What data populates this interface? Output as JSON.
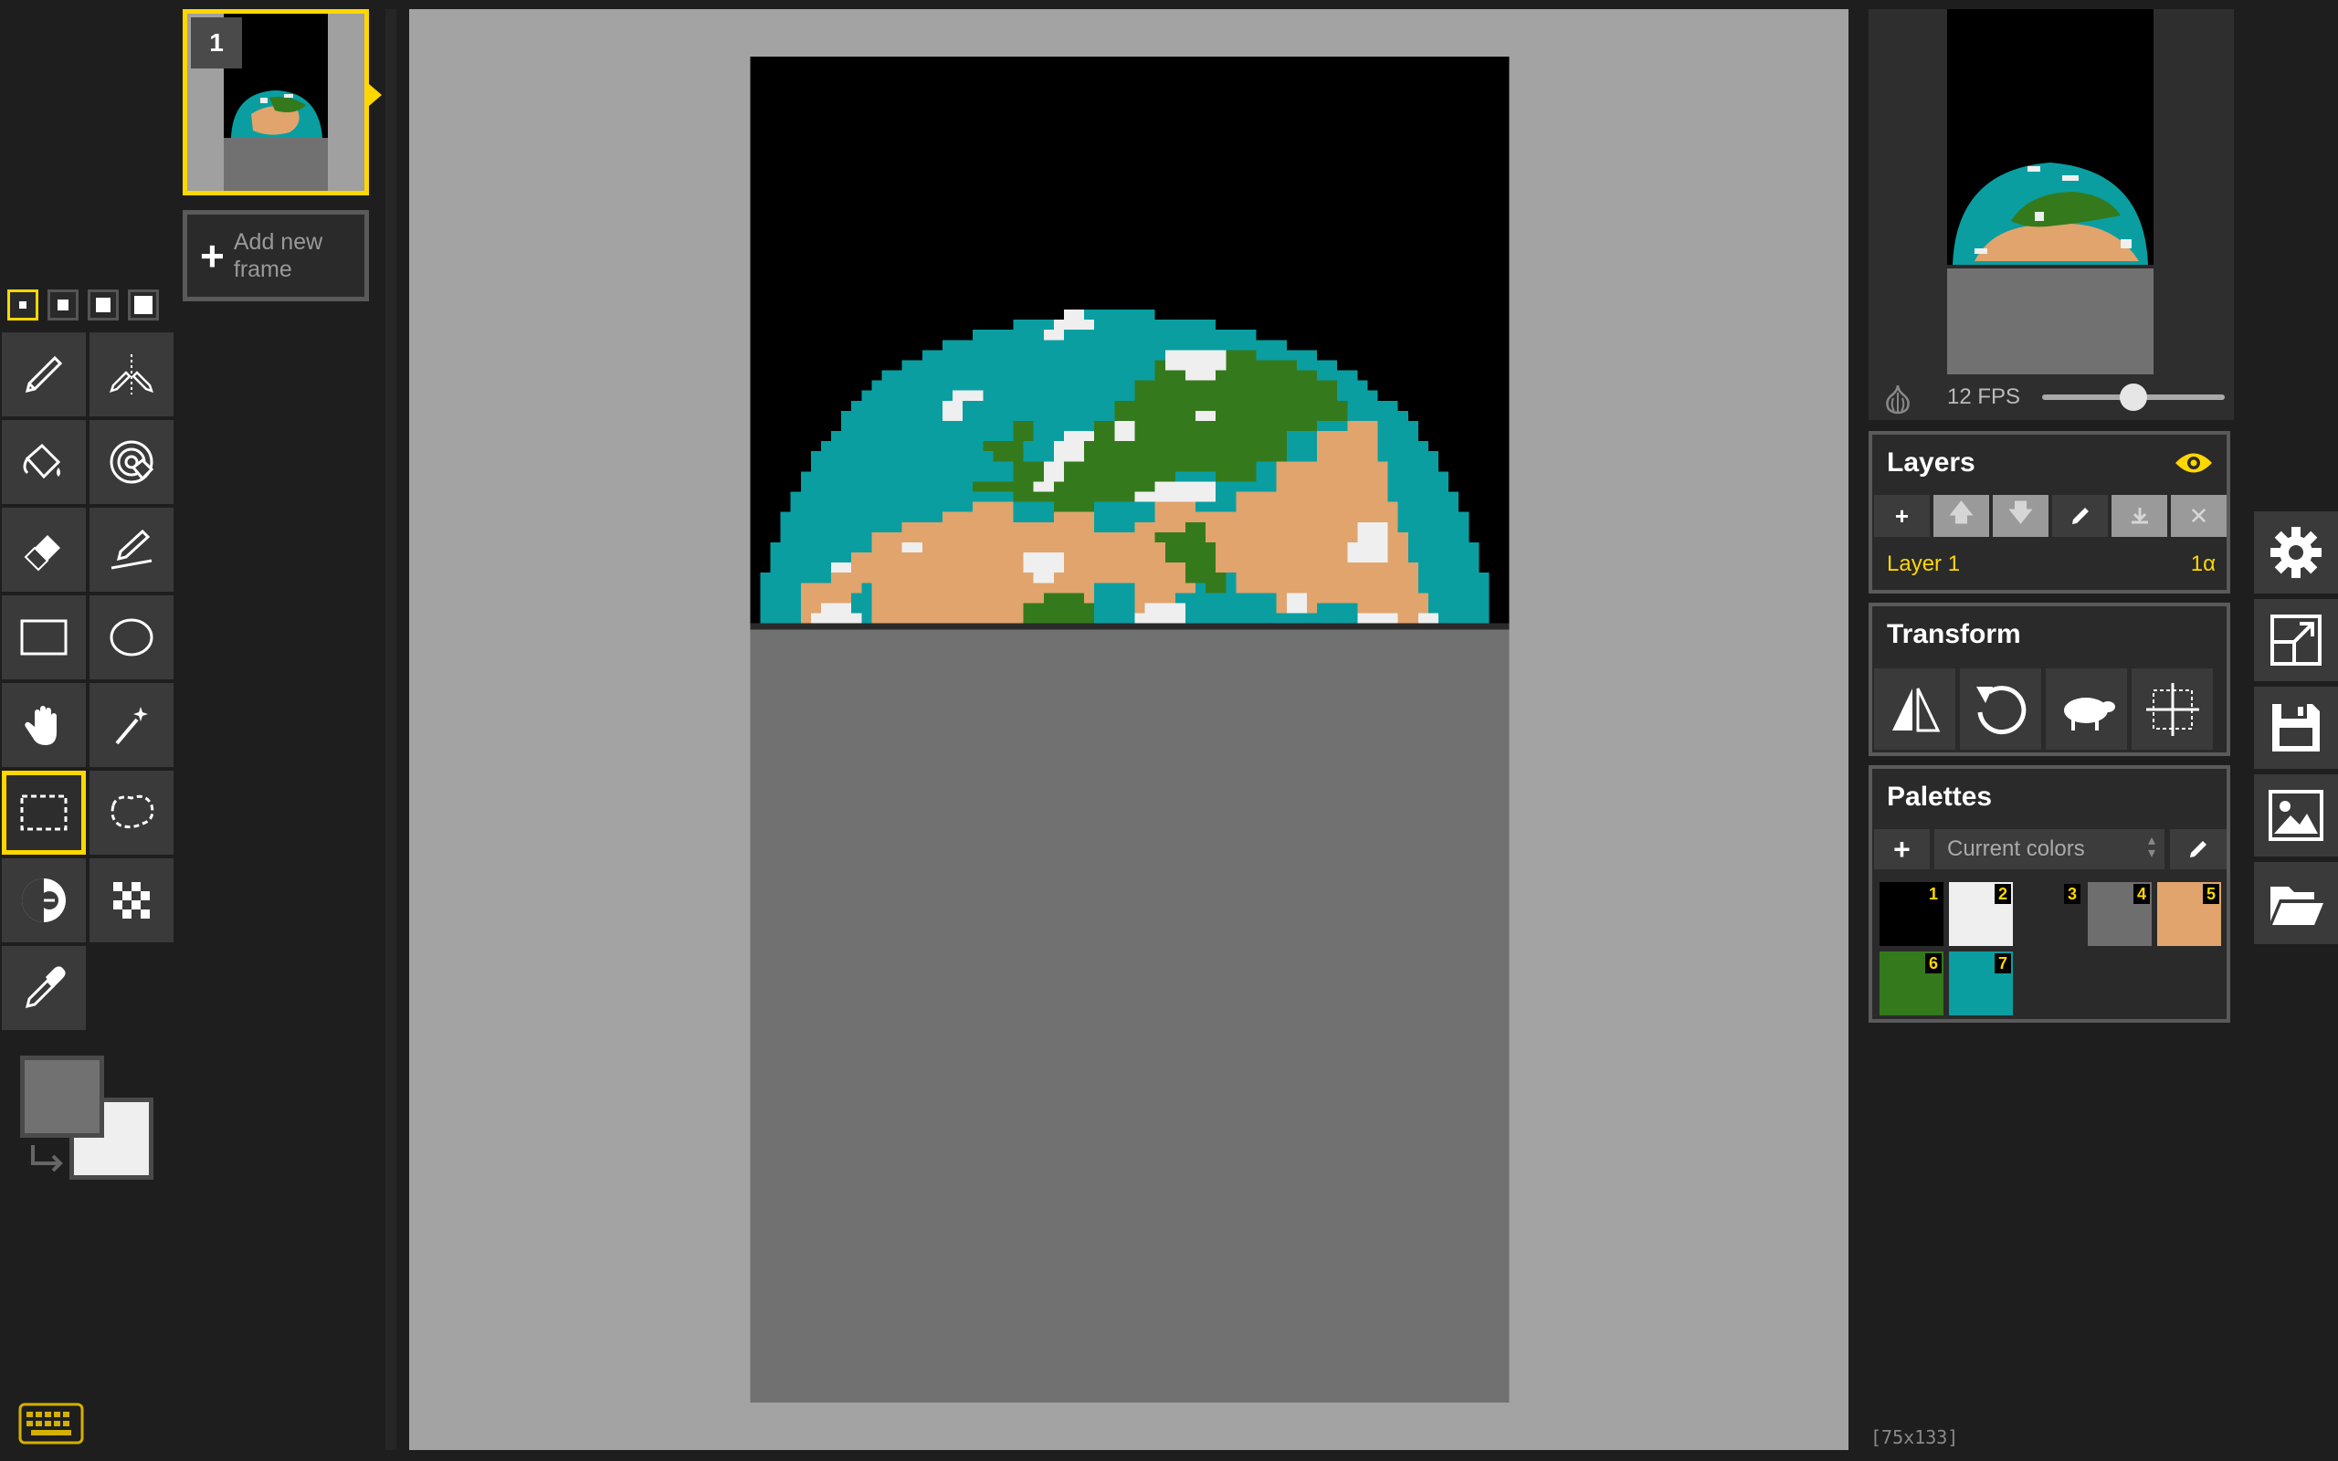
{
  "pen_sizes": [
    "1",
    "2",
    "3",
    "4"
  ],
  "tools": [
    {
      "name": "pen-tool",
      "icon": "pencil-icon"
    },
    {
      "name": "vertical-mirror-pen-tool",
      "icon": "mirror-pen-icon"
    },
    {
      "name": "paint-bucket-tool",
      "icon": "bucket-icon"
    },
    {
      "name": "paint-all-same-color-tool",
      "icon": "target-bucket-icon"
    },
    {
      "name": "eraser-tool",
      "icon": "eraser-icon"
    },
    {
      "name": "stroke-tool",
      "icon": "stroke-pen-icon"
    },
    {
      "name": "rectangle-tool",
      "icon": "rectangle-icon"
    },
    {
      "name": "circle-tool",
      "icon": "circle-icon"
    },
    {
      "name": "move-tool",
      "icon": "hand-icon"
    },
    {
      "name": "shape-selection-tool",
      "icon": "magic-wand-icon"
    },
    {
      "name": "rectangle-selection-tool",
      "icon": "dashed-rectangle-icon",
      "selected": true
    },
    {
      "name": "lasso-selection-tool",
      "icon": "lasso-icon"
    },
    {
      "name": "lighten-tool",
      "icon": "lighten-icon"
    },
    {
      "name": "dithering-tool",
      "icon": "checker-icon"
    },
    {
      "name": "color-picker-tool",
      "icon": "eyedropper-icon"
    }
  ],
  "colors": {
    "primary": "#717171",
    "secondary": "#efefef",
    "accent": "#ffd700"
  },
  "frames": {
    "current_number": "1",
    "add_label": "Add new frame"
  },
  "preview": {
    "fps_label": "12 FPS",
    "fps_level": 0.5
  },
  "layers": {
    "title": "Layers",
    "items": [
      {
        "name": "Layer 1",
        "opacity": "1α"
      }
    ]
  },
  "transform": {
    "title": "Transform"
  },
  "palettes": {
    "title": "Palettes",
    "selected": "Current colors",
    "swatches": [
      {
        "n": "1",
        "color": "#000000"
      },
      {
        "n": "2",
        "color": "#efefef"
      },
      {
        "n": "3",
        "color": "#2a2a2a"
      },
      {
        "n": "4",
        "color": "#6e6e6e"
      },
      {
        "n": "5",
        "color": "#e0a46c"
      },
      {
        "n": "6",
        "color": "#347a1c"
      },
      {
        "n": "7",
        "color": "#0a9ea1"
      }
    ]
  },
  "status": {
    "dimensions": "[75x133]"
  }
}
